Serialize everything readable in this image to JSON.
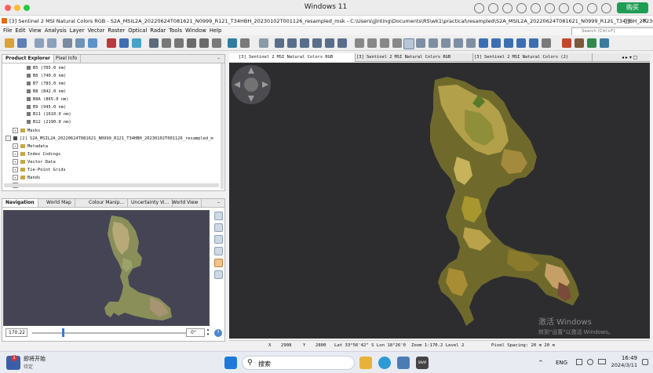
{
  "host": {
    "title": "Windows 11",
    "buy_label": "购买"
  },
  "app": {
    "title": "[3] Sentinel 2 MSI Natural Colors RGB - S2A_MSIL2A_20220624T081621_N0999_R121_T34HBH_20230102T001126_resampled_msk - C:\\Users\\jjinting\\Documents\\RS\\wk1\\practical\\resampled\\S2A_MSIL2A_20220624T081621_N0999_R121_T34HBH_2023010..."
  },
  "menu": [
    "File",
    "Edit",
    "View",
    "Analysis",
    "Layer",
    "Vector",
    "Raster",
    "Optical",
    "Radar",
    "Tools",
    "Window",
    "Help"
  ],
  "search": {
    "placeholder": "Search (Ctrl+F)"
  },
  "product_panel": {
    "tabs": [
      "Product Explorer",
      "Pixel Info"
    ],
    "rows": [
      {
        "text": "B5 (705.0 nm)",
        "indent": 3,
        "kind": "band"
      },
      {
        "text": "B6 (740.0 nm)",
        "indent": 3,
        "kind": "band"
      },
      {
        "text": "B7 (783.0 nm)",
        "indent": 3,
        "kind": "band"
      },
      {
        "text": "B8 (842.0 nm)",
        "indent": 3,
        "kind": "band"
      },
      {
        "text": "B8A (865.0 nm)",
        "indent": 3,
        "kind": "band"
      },
      {
        "text": "B9 (945.0 nm)",
        "indent": 3,
        "kind": "band"
      },
      {
        "text": "B11 (1610.0 nm)",
        "indent": 3,
        "kind": "band"
      },
      {
        "text": "B12 (2190.0 nm)",
        "indent": 3,
        "kind": "band"
      },
      {
        "text": "Masks",
        "indent": 1,
        "kind": "folder"
      },
      {
        "text": "[2] S2A_MSIL2A_20220624T081621_N0999_R121_T34HBH_20230102T001126_resampled_m",
        "indent": 0,
        "kind": "product"
      },
      {
        "text": "Metadata",
        "indent": 1,
        "kind": "folder"
      },
      {
        "text": "Index Codings",
        "indent": 1,
        "kind": "folder"
      },
      {
        "text": "Vector Data",
        "indent": 1,
        "kind": "folder"
      },
      {
        "text": "Tie-Point Grids",
        "indent": 1,
        "kind": "folder"
      },
      {
        "text": "Bands",
        "indent": 1,
        "kind": "folder"
      },
      {
        "text": "Masks",
        "indent": 1,
        "kind": "folder"
      }
    ]
  },
  "nav_panel": {
    "tabs": [
      "Navigation",
      "World Map",
      "Colour Manip...",
      "Uncertainty Vi...",
      "World View"
    ],
    "zoom_value": "170.22",
    "zoom_slider_fraction": 0.2,
    "rotation_value": "0°"
  },
  "main": {
    "tabs": [
      "[3] Sentinel 2 MSI Natural Colors RGB",
      "[3] Sentinel 2 MSI Natural Colors RGB",
      "[3] Sentinel 2 MSI Natural Colors (2)"
    ],
    "watermark_line1": "激活 Windows",
    "watermark_line2": "转到\"设置\"以激活 Windows。"
  },
  "status": {
    "x_label": "X",
    "x_value": "2908",
    "y_label": "Y",
    "y_value": "2800",
    "latlon": "Lat 33°56'42\" S  Lon 18°26'0",
    "zoom_level": "Zoom 1:170.2  Level 2",
    "pixel_spacing": "Pixel Spacing: 20 m 20 m"
  },
  "taskbar": {
    "notification_count": "1",
    "start_text": "即将开始",
    "start_subtext": "待定",
    "search_label": "搜索",
    "lang": "ENG",
    "time": "16:49",
    "date": "2024/3/11"
  },
  "colors": {
    "accent": "#1f9d55",
    "map_bg": "#2d2d30",
    "nav_bg": "#444455"
  }
}
